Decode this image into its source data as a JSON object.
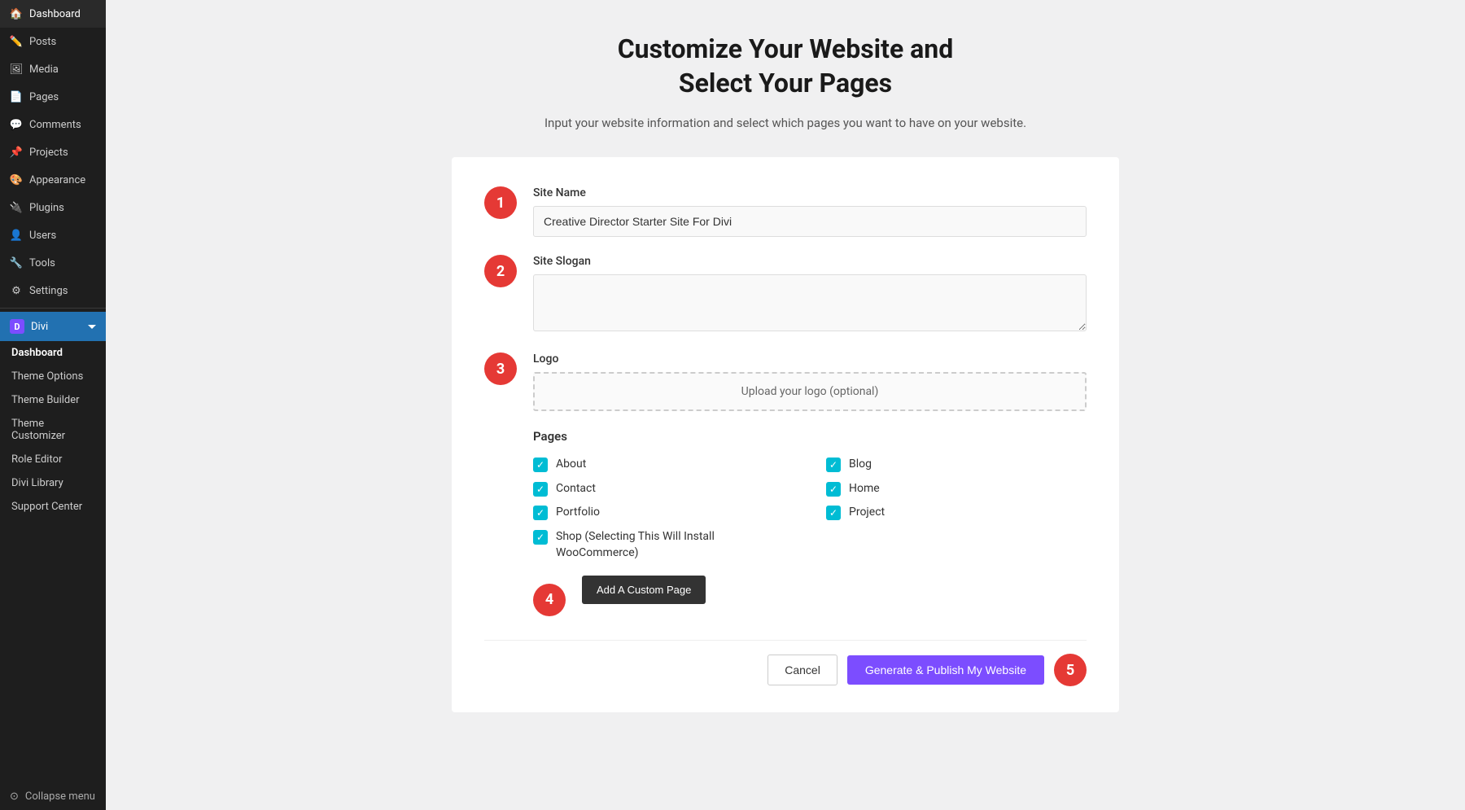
{
  "sidebar": {
    "items": [
      {
        "id": "dashboard",
        "label": "Dashboard",
        "icon": "🏠"
      },
      {
        "id": "posts",
        "label": "Posts",
        "icon": "📝"
      },
      {
        "id": "media",
        "label": "Media",
        "icon": "🖼"
      },
      {
        "id": "pages",
        "label": "Pages",
        "icon": "📄"
      },
      {
        "id": "comments",
        "label": "Comments",
        "icon": "💬"
      },
      {
        "id": "projects",
        "label": "Projects",
        "icon": "📌"
      },
      {
        "id": "appearance",
        "label": "Appearance",
        "icon": "🎨"
      },
      {
        "id": "plugins",
        "label": "Plugins",
        "icon": "🔌"
      },
      {
        "id": "users",
        "label": "Users",
        "icon": "👤"
      },
      {
        "id": "tools",
        "label": "Tools",
        "icon": "🔧"
      },
      {
        "id": "settings",
        "label": "Settings",
        "icon": "⚙"
      }
    ],
    "divi": {
      "label": "Divi",
      "subitems": [
        {
          "id": "divi-dashboard",
          "label": "Dashboard",
          "active": true
        },
        {
          "id": "theme-options",
          "label": "Theme Options"
        },
        {
          "id": "theme-builder",
          "label": "Theme Builder"
        },
        {
          "id": "theme-customizer",
          "label": "Theme Customizer"
        },
        {
          "id": "role-editor",
          "label": "Role Editor"
        },
        {
          "id": "divi-library",
          "label": "Divi Library"
        },
        {
          "id": "support-center",
          "label": "Support Center"
        }
      ]
    },
    "collapse_label": "Collapse menu"
  },
  "main": {
    "title_line1": "Customize Your Website and",
    "title_line2": "Select Your Pages",
    "subtitle": "Input your website information and select which pages you want to have on your website.",
    "form": {
      "site_name_label": "Site Name",
      "site_name_value": "Creative Director Starter Site For Divi",
      "site_slogan_label": "Site Slogan",
      "site_slogan_value": "",
      "logo_label": "Logo",
      "logo_upload_text": "Upload your logo (optional)",
      "pages_label": "Pages",
      "pages": [
        {
          "id": "about",
          "label": "About",
          "checked": true
        },
        {
          "id": "blog",
          "label": "Blog",
          "checked": true
        },
        {
          "id": "contact",
          "label": "Contact",
          "checked": true
        },
        {
          "id": "home",
          "label": "Home",
          "checked": true
        },
        {
          "id": "portfolio",
          "label": "Portfolio",
          "checked": true
        },
        {
          "id": "project",
          "label": "Project",
          "checked": true
        },
        {
          "id": "shop",
          "label": "Shop (Selecting This Will Install WooCommerce)",
          "checked": true
        }
      ],
      "add_custom_label": "Add A Custom Page",
      "cancel_label": "Cancel",
      "publish_label": "Generate & Publish My Website"
    },
    "steps": [
      "1",
      "2",
      "3",
      "4",
      "5"
    ]
  }
}
